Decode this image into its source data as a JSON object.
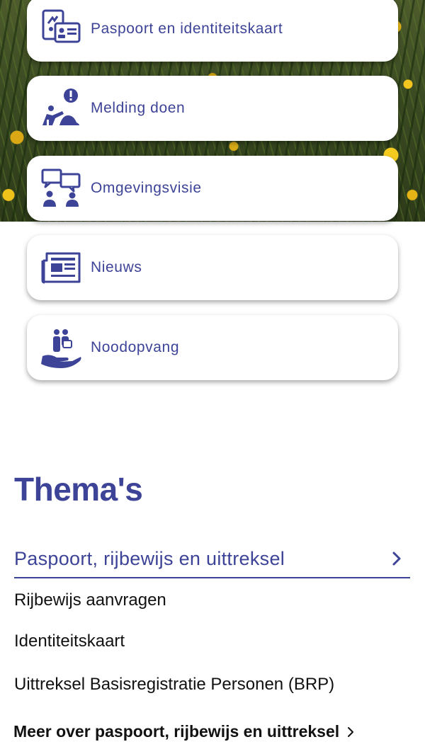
{
  "hero": {
    "image": "yellow-flowers-field-photo"
  },
  "quick_links": [
    {
      "label": "Paspoort en identiteitskaart",
      "icon": "passport-id-card-icon"
    },
    {
      "label": "Melding doen",
      "icon": "report-incident-icon"
    },
    {
      "label": "Omgevingsvisie",
      "icon": "people-speech-bubbles-icon"
    },
    {
      "label": "Nieuws",
      "icon": "newspaper-icon"
    },
    {
      "label": "Noodopvang",
      "icon": "emergency-shelter-hands-icon"
    }
  ],
  "themes": {
    "title": "Thema's",
    "section": {
      "label": "Paspoort, rijbewijs en uittreksel",
      "icon": "chevron-right-icon",
      "links": [
        "Rijbewijs aanvragen",
        "Identiteitskaart",
        "Uittreksel Basisregistratie Personen (BRP)"
      ],
      "more_label": "Meer over paspoort, rijbewijs en uittreksel"
    }
  },
  "colors": {
    "accent": "#3d4396",
    "text": "#111111",
    "background": "#ffffff"
  }
}
